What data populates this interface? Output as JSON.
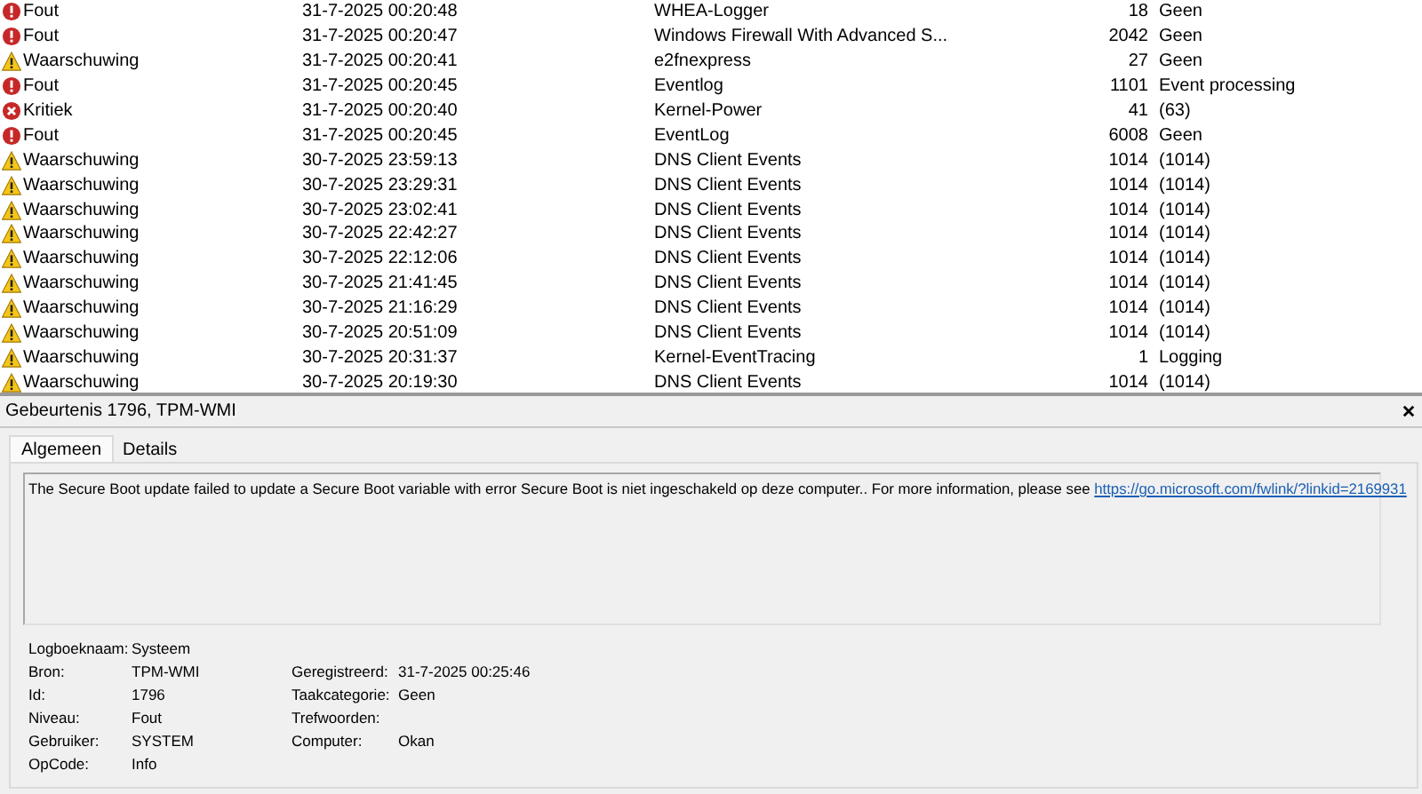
{
  "events": [
    {
      "kind": "error",
      "level": "Fout",
      "date": "31-7-2025 00:20:48",
      "source": "WHEA-Logger",
      "id": "18",
      "task": "Geen"
    },
    {
      "kind": "error",
      "level": "Fout",
      "date": "31-7-2025 00:20:47",
      "source": "Windows Firewall With Advanced S...",
      "id": "2042",
      "task": "Geen"
    },
    {
      "kind": "warning",
      "level": "Waarschuwing",
      "date": "31-7-2025 00:20:41",
      "source": "e2fnexpress",
      "id": "27",
      "task": "Geen"
    },
    {
      "kind": "error",
      "level": "Fout",
      "date": "31-7-2025 00:20:45",
      "source": "Eventlog",
      "id": "1101",
      "task": "Event processing"
    },
    {
      "kind": "critical",
      "level": "Kritiek",
      "date": "31-7-2025 00:20:40",
      "source": "Kernel-Power",
      "id": "41",
      "task": "(63)"
    },
    {
      "kind": "error",
      "level": "Fout",
      "date": "31-7-2025 00:20:45",
      "source": "EventLog",
      "id": "6008",
      "task": "Geen"
    },
    {
      "kind": "warning",
      "level": "Waarschuwing",
      "date": "30-7-2025 23:59:13",
      "source": "DNS Client Events",
      "id": "1014",
      "task": "(1014)"
    },
    {
      "kind": "warning",
      "level": "Waarschuwing",
      "date": "30-7-2025 23:29:31",
      "source": "DNS Client Events",
      "id": "1014",
      "task": "(1014)"
    },
    {
      "kind": "warning",
      "level": "Waarschuwing",
      "date": "30-7-2025 23:02:41",
      "source": "DNS Client Events",
      "id": "1014",
      "task": "(1014)"
    },
    {
      "kind": "warning",
      "level": "Waarschuwing",
      "date": "30-7-2025 22:42:27",
      "source": "DNS Client Events",
      "id": "1014",
      "task": "(1014)"
    },
    {
      "kind": "warning",
      "level": "Waarschuwing",
      "date": "30-7-2025 22:12:06",
      "source": "DNS Client Events",
      "id": "1014",
      "task": "(1014)"
    },
    {
      "kind": "warning",
      "level": "Waarschuwing",
      "date": "30-7-2025 21:41:45",
      "source": "DNS Client Events",
      "id": "1014",
      "task": "(1014)"
    },
    {
      "kind": "warning",
      "level": "Waarschuwing",
      "date": "30-7-2025 21:16:29",
      "source": "DNS Client Events",
      "id": "1014",
      "task": "(1014)"
    },
    {
      "kind": "warning",
      "level": "Waarschuwing",
      "date": "30-7-2025 20:51:09",
      "source": "DNS Client Events",
      "id": "1014",
      "task": "(1014)"
    },
    {
      "kind": "warning",
      "level": "Waarschuwing",
      "date": "30-7-2025 20:31:37",
      "source": "Kernel-EventTracing",
      "id": "1",
      "task": "Logging"
    },
    {
      "kind": "warning",
      "level": "Waarschuwing",
      "date": "30-7-2025 20:19:30",
      "source": "DNS Client Events",
      "id": "1014",
      "task": "(1014)"
    }
  ],
  "details": {
    "title": "Gebeurtenis 1796, TPM-WMI",
    "tabs": [
      {
        "label": "Algemeen",
        "selected": true
      },
      {
        "label": "Details",
        "selected": false
      }
    ],
    "message": "The Secure Boot update failed to update a Secure Boot variable with error Secure Boot is niet ingeschakeld op deze computer.. For more information, please see",
    "link": "https://go.microsoft.com/fwlink/?linkid=2169931",
    "properties": [
      {
        "label": "Logboeknaam:",
        "value": "Systeem"
      },
      {
        "label": "Bron:",
        "value": "TPM-WMI",
        "right_label": "Geregistreerd:",
        "right_value": "31-7-2025 00:25:46"
      },
      {
        "label": "Id:",
        "value": "1796",
        "right_label": "Taakcategorie:",
        "right_value": "Geen"
      },
      {
        "label": "Niveau:",
        "value": "Fout",
        "right_label": "Trefwoorden:"
      },
      {
        "label": "Gebruiker:",
        "value": "SYSTEM",
        "right_label": "Computer:",
        "right_value": "Okan"
      },
      {
        "label": "OpCode:",
        "value": "Info"
      }
    ]
  }
}
